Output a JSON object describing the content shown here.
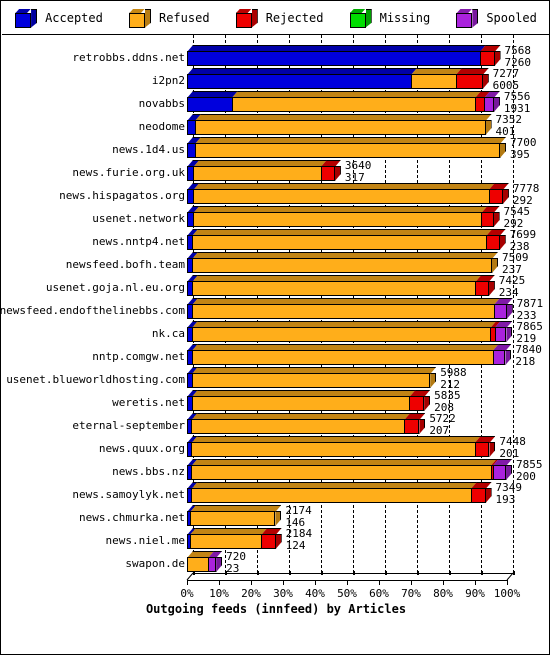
{
  "legend": {
    "items": [
      {
        "label": "Accepted",
        "color": "#0000dd",
        "icon": "cube-icon"
      },
      {
        "label": "Refused",
        "color": "#ffae1a",
        "icon": "cube-icon"
      },
      {
        "label": "Rejected",
        "color": "#ee0000",
        "icon": "cube-icon"
      },
      {
        "label": "Missing",
        "color": "#00dd00",
        "icon": "cube-icon"
      },
      {
        "label": "Spooled",
        "color": "#aa22dd",
        "icon": "cube-icon"
      }
    ]
  },
  "chart_data": {
    "type": "bar",
    "orientation": "horizontal",
    "stacked": true,
    "title": "",
    "xlabel": "Outgoing feeds (innfeed) by Articles",
    "ylabel": "",
    "xlim": [
      0,
      100
    ],
    "xunit": "%",
    "xticks": [
      "0%",
      "10%",
      "20%",
      "30%",
      "40%",
      "50%",
      "60%",
      "70%",
      "80%",
      "90%",
      "100%"
    ],
    "grid": true,
    "legend_position": "top",
    "series": [
      {
        "name": "Accepted",
        "color": "#0000dd"
      },
      {
        "name": "Refused",
        "color": "#ffae1a"
      },
      {
        "name": "Rejected",
        "color": "#ee0000"
      },
      {
        "name": "Missing",
        "color": "#00dd00"
      },
      {
        "name": "Spooled",
        "color": "#aa22dd"
      }
    ],
    "categories": [
      "retrobbs.ddns.net",
      "i2pn2",
      "novabbs",
      "neodome",
      "news.1d4.us",
      "news.furie.org.uk",
      "news.hispagatos.org",
      "usenet.network",
      "news.nntp4.net",
      "newsfeed.bofh.team",
      "usenet.goja.nl.eu.org",
      "newsfeed.endofthelinebbs.com",
      "nk.ca",
      "nntp.comgw.net",
      "usenet.blueworldhosting.com",
      "weretis.net",
      "eternal-september",
      "news.quux.org",
      "news.bbs.nz",
      "news.samoylyk.net",
      "news.chmurka.net",
      "news.niel.me",
      "swapon.de"
    ],
    "rows": [
      {
        "label": "retrobbs.ddns.net",
        "total": 7568,
        "secondary": 7260,
        "pct": 96.1,
        "segments": [
          {
            "s": "Accepted",
            "pct": 91.5
          },
          {
            "s": "Rejected",
            "pct": 4.6
          }
        ]
      },
      {
        "label": "i2pn2",
        "total": 7277,
        "secondary": 6005,
        "pct": 92.4,
        "segments": [
          {
            "s": "Accepted",
            "pct": 70.0
          },
          {
            "s": "Refused",
            "pct": 14.0
          },
          {
            "s": "Rejected",
            "pct": 8.4
          }
        ]
      },
      {
        "label": "novabbs",
        "total": 7556,
        "secondary": 1931,
        "pct": 95.9,
        "segments": [
          {
            "s": "Accepted",
            "pct": 14.0
          },
          {
            "s": "Refused",
            "pct": 76.0
          },
          {
            "s": "Rejected",
            "pct": 2.9
          },
          {
            "s": "Spooled",
            "pct": 3.0
          }
        ]
      },
      {
        "label": "neodome",
        "total": 7352,
        "secondary": 401,
        "pct": 93.3,
        "segments": [
          {
            "s": "Accepted",
            "pct": 2.5
          },
          {
            "s": "Refused",
            "pct": 90.8
          }
        ]
      },
      {
        "label": "news.1d4.us",
        "total": 7700,
        "secondary": 395,
        "pct": 97.8,
        "segments": [
          {
            "s": "Accepted",
            "pct": 2.5
          },
          {
            "s": "Refused",
            "pct": 95.3
          }
        ]
      },
      {
        "label": "news.furie.org.uk",
        "total": 3640,
        "secondary": 317,
        "pct": 46.2,
        "segments": [
          {
            "s": "Accepted",
            "pct": 2.0
          },
          {
            "s": "Refused",
            "pct": 39.8
          },
          {
            "s": "Rejected",
            "pct": 4.4
          }
        ]
      },
      {
        "label": "news.hispagatos.org",
        "total": 7778,
        "secondary": 292,
        "pct": 98.7,
        "segments": [
          {
            "s": "Accepted",
            "pct": 2.0
          },
          {
            "s": "Refused",
            "pct": 92.3
          },
          {
            "s": "Rejected",
            "pct": 4.4
          }
        ]
      },
      {
        "label": "usenet.network",
        "total": 7545,
        "secondary": 292,
        "pct": 95.8,
        "segments": [
          {
            "s": "Accepted",
            "pct": 2.0
          },
          {
            "s": "Refused",
            "pct": 90.0
          },
          {
            "s": "Rejected",
            "pct": 3.8
          }
        ]
      },
      {
        "label": "news.nntp4.net",
        "total": 7699,
        "secondary": 238,
        "pct": 97.7,
        "segments": [
          {
            "s": "Accepted",
            "pct": 1.6
          },
          {
            "s": "Refused",
            "pct": 91.9
          },
          {
            "s": "Rejected",
            "pct": 4.2
          }
        ]
      },
      {
        "label": "newsfeed.bofh.team",
        "total": 7509,
        "secondary": 237,
        "pct": 95.3,
        "segments": [
          {
            "s": "Accepted",
            "pct": 1.6
          },
          {
            "s": "Refused",
            "pct": 93.7
          }
        ]
      },
      {
        "label": "usenet.goja.nl.eu.org",
        "total": 7425,
        "secondary": 234,
        "pct": 94.3,
        "segments": [
          {
            "s": "Accepted",
            "pct": 1.6
          },
          {
            "s": "Refused",
            "pct": 88.5
          },
          {
            "s": "Rejected",
            "pct": 4.2
          }
        ]
      },
      {
        "label": "newsfeed.endofthelinebbs.com",
        "total": 7871,
        "secondary": 233,
        "pct": 99.9,
        "segments": [
          {
            "s": "Accepted",
            "pct": 1.6
          },
          {
            "s": "Refused",
            "pct": 94.3
          },
          {
            "s": "Spooled",
            "pct": 4.0
          }
        ]
      },
      {
        "label": "nk.ca",
        "total": 7865,
        "secondary": 219,
        "pct": 99.8,
        "segments": [
          {
            "s": "Accepted",
            "pct": 1.5
          },
          {
            "s": "Refused",
            "pct": 93.3
          },
          {
            "s": "Rejected",
            "pct": 1.3
          },
          {
            "s": "Spooled",
            "pct": 3.7
          }
        ]
      },
      {
        "label": "nntp.comgw.net",
        "total": 7840,
        "secondary": 218,
        "pct": 99.5,
        "segments": [
          {
            "s": "Accepted",
            "pct": 1.5
          },
          {
            "s": "Refused",
            "pct": 94.0
          },
          {
            "s": "Spooled",
            "pct": 4.0
          }
        ]
      },
      {
        "label": "usenet.blueworldhosting.com",
        "total": 5988,
        "secondary": 212,
        "pct": 76.0,
        "segments": [
          {
            "s": "Accepted",
            "pct": 1.5
          },
          {
            "s": "Refused",
            "pct": 74.5
          }
        ]
      },
      {
        "label": "weretis.net",
        "total": 5835,
        "secondary": 208,
        "pct": 74.1,
        "segments": [
          {
            "s": "Accepted",
            "pct": 1.5
          },
          {
            "s": "Refused",
            "pct": 68.0
          },
          {
            "s": "Rejected",
            "pct": 4.6
          }
        ]
      },
      {
        "label": "eternal-september",
        "total": 5722,
        "secondary": 207,
        "pct": 72.6,
        "segments": [
          {
            "s": "Accepted",
            "pct": 1.4
          },
          {
            "s": "Refused",
            "pct": 66.5
          },
          {
            "s": "Rejected",
            "pct": 4.7
          }
        ]
      },
      {
        "label": "news.quux.org",
        "total": 7448,
        "secondary": 201,
        "pct": 94.5,
        "segments": [
          {
            "s": "Accepted",
            "pct": 1.4
          },
          {
            "s": "Refused",
            "pct": 88.5
          },
          {
            "s": "Rejected",
            "pct": 4.6
          }
        ]
      },
      {
        "label": "news.bbs.nz",
        "total": 7855,
        "secondary": 200,
        "pct": 99.7,
        "segments": [
          {
            "s": "Accepted",
            "pct": 1.4
          },
          {
            "s": "Refused",
            "pct": 93.5
          },
          {
            "s": "Rejected",
            "pct": 0.6
          },
          {
            "s": "Spooled",
            "pct": 4.2
          }
        ]
      },
      {
        "label": "news.samoylyk.net",
        "total": 7349,
        "secondary": 193,
        "pct": 93.3,
        "segments": [
          {
            "s": "Accepted",
            "pct": 1.4
          },
          {
            "s": "Refused",
            "pct": 87.3
          },
          {
            "s": "Rejected",
            "pct": 4.6
          }
        ]
      },
      {
        "label": "news.chmurka.net",
        "total": 2174,
        "secondary": 146,
        "pct": 27.6,
        "segments": [
          {
            "s": "Accepted",
            "pct": 1.0
          },
          {
            "s": "Refused",
            "pct": 26.6
          }
        ]
      },
      {
        "label": "news.niel.me",
        "total": 2184,
        "secondary": 124,
        "pct": 27.7,
        "segments": [
          {
            "s": "Accepted",
            "pct": 0.9
          },
          {
            "s": "Refused",
            "pct": 22.3
          },
          {
            "s": "Rejected",
            "pct": 4.5
          }
        ]
      },
      {
        "label": "swapon.de",
        "total": 720,
        "secondary": 23,
        "pct": 9.1,
        "segments": [
          {
            "s": "Refused",
            "pct": 6.6
          },
          {
            "s": "Spooled",
            "pct": 2.5
          }
        ]
      }
    ]
  },
  "colors": {
    "accepted": "#0000dd",
    "refused": "#ffae1a",
    "rejected": "#ee0000",
    "missing": "#00dd00",
    "spooled": "#aa22dd",
    "background": "#ffffff",
    "outline": "#000000"
  }
}
